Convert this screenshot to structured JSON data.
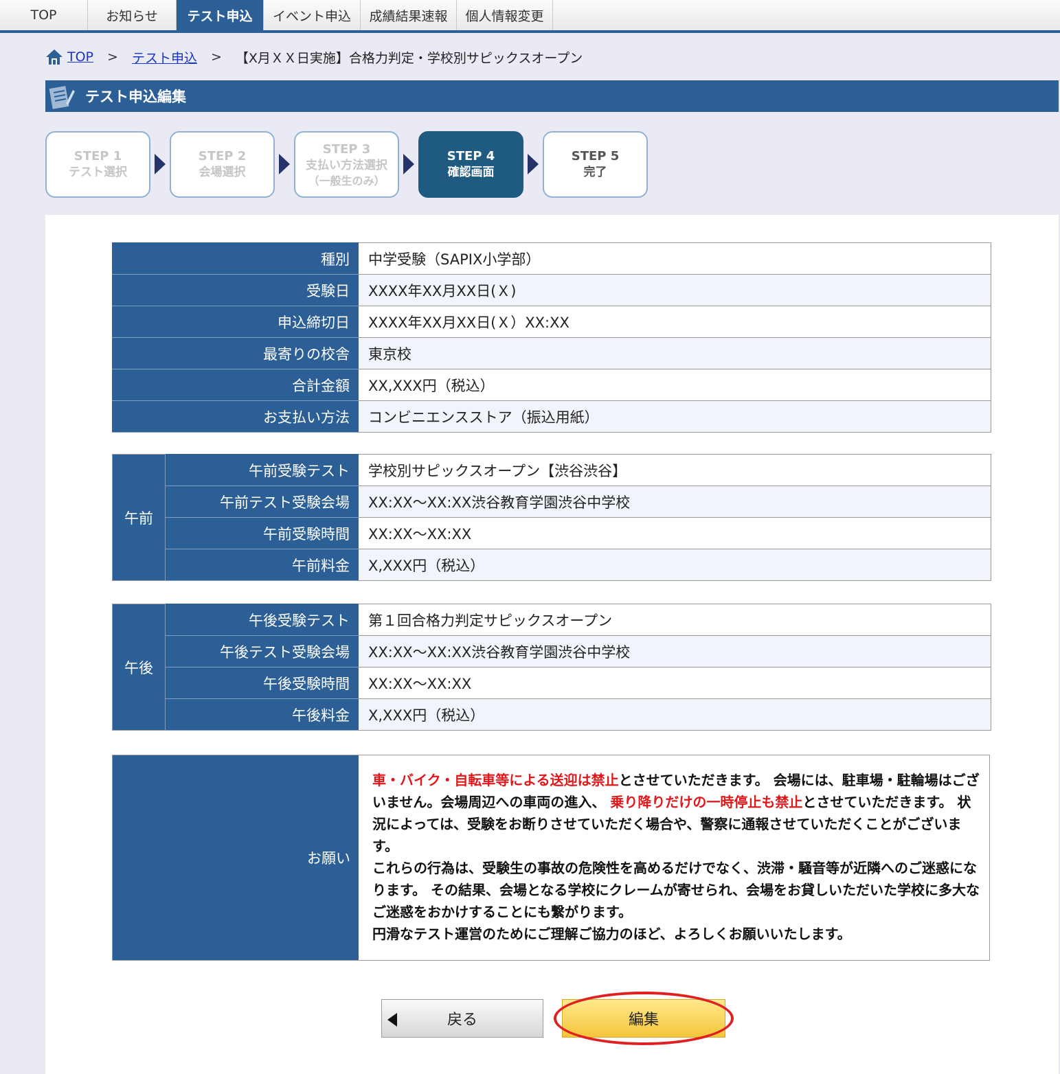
{
  "topnav": {
    "tabs": [
      {
        "label": "TOP"
      },
      {
        "label": "お知らせ"
      },
      {
        "label": "テスト申込",
        "active": true
      },
      {
        "label": "イベント申込"
      },
      {
        "label": "成績結果速報"
      },
      {
        "label": "個人情報変更"
      }
    ]
  },
  "breadcrumb": {
    "home": "TOP",
    "sep": ">",
    "level2": "テスト申込",
    "current": "【X月ＸＸ日実施】合格力判定・学校別サピックスオープン"
  },
  "section_title": "テスト申込編集",
  "steps": [
    {
      "num": "STEP 1",
      "label": "テスト選択",
      "state": "done"
    },
    {
      "num": "STEP 2",
      "label": "会場選択",
      "state": "done"
    },
    {
      "num": "STEP 3",
      "label": "支払い方法選択",
      "sub": "（一般生のみ）",
      "state": "done"
    },
    {
      "num": "STEP 4",
      "label": "確認画面",
      "state": "current"
    },
    {
      "num": "STEP 5",
      "label": "完了",
      "state": "todo"
    }
  ],
  "summary": [
    {
      "label": "種別",
      "value": "中学受験（SAPIX小学部）"
    },
    {
      "label": "受験日",
      "value": "XXXX年XX月XX日(Ｘ)"
    },
    {
      "label": "申込締切日",
      "value": "XXXX年XX月XX日(Ｘ）XX:XX"
    },
    {
      "label": "最寄りの校舎",
      "value": "東京校"
    },
    {
      "label": "合計金額",
      "value": "XX,XXX円（税込）"
    },
    {
      "label": "お支払い方法",
      "value": "コンビニエンスストア（振込用紙）"
    }
  ],
  "morning": {
    "group": "午前",
    "rows": [
      {
        "label": "午前受験テスト",
        "value": "学校別サピックスオープン【渋谷渋谷】"
      },
      {
        "label": "午前テスト受験会場",
        "value": "XX:XX～XX:XX渋谷教育学園渋谷中学校"
      },
      {
        "label": "午前受験時間",
        "value": "XX:XX～XX:XX"
      },
      {
        "label": "午前料金",
        "value": "X,XXX円（税込）"
      }
    ]
  },
  "afternoon": {
    "group": "午後",
    "rows": [
      {
        "label": "午後受験テスト",
        "value": "第１回合格力判定サピックスオープン"
      },
      {
        "label": "午後テスト受験会場",
        "value": "XX:XX～XX:XX渋谷教育学園渋谷中学校"
      },
      {
        "label": "午後受験時間",
        "value": "XX:XX～XX:XX"
      },
      {
        "label": "午後料金",
        "value": "X,XXX円（税込）"
      }
    ]
  },
  "notice": {
    "heading": "お願い",
    "red1": "車・バイク・自転車等による送迎は禁止",
    "text1": "とさせていただきます。 会場には、駐車場・駐輪場はございません。会場周辺への車両の進入、 ",
    "red2": "乗り降りだけの一時停止も禁止",
    "text2": "とさせていただきます。 状況によっては、受験をお断りさせていただく場合や、警察に通報させていただくことがございます。",
    "para2": "これらの行為は、受験生の事故の危険性を高めるだけでなく、渋滞・騒音等が近隣へのご迷惑になります。 その結果、会場となる学校にクレームが寄せられ、会場をお貸しいただいた学校に多大なご迷惑をおかけすることにも繋がります。",
    "para3": "円滑なテスト運営のためにご理解ご協力のほど、よろしくお願いいたします。"
  },
  "buttons": {
    "back": "戻る",
    "edit": "編集"
  },
  "colors": {
    "primary": "#2c5f95",
    "current_step": "#1f5a80",
    "warning_red": "#e0181b",
    "edit_button": "#f5c53c"
  }
}
